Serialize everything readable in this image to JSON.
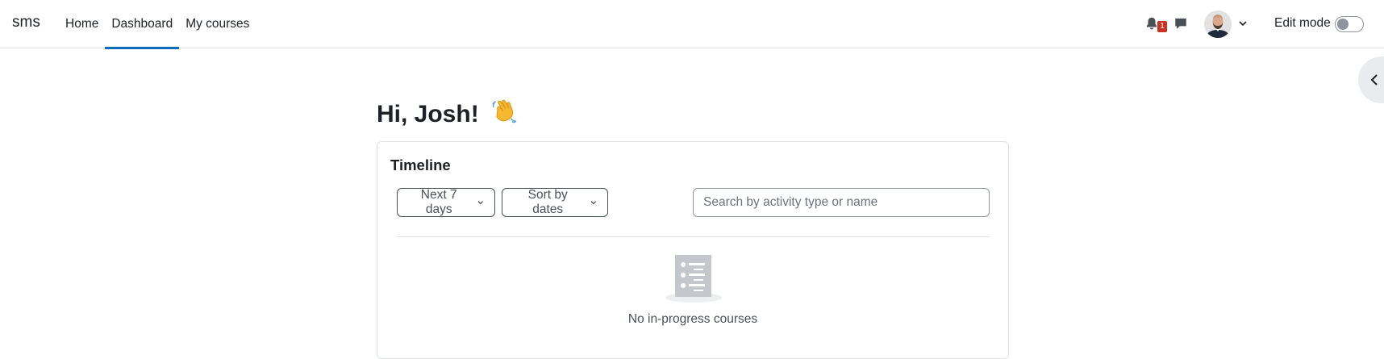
{
  "navbar": {
    "brand": "sms",
    "items": [
      {
        "label": "Home",
        "active": false
      },
      {
        "label": "Dashboard",
        "active": true
      },
      {
        "label": "My courses",
        "active": false
      }
    ],
    "notification_count": "1",
    "edit_mode_label": "Edit mode",
    "edit_mode_on": false,
    "accent_color": "#0f6cbf",
    "badge_color": "#ca3120"
  },
  "main": {
    "greeting": "Hi, Josh!",
    "greeting_emoji": "wave-icon"
  },
  "timeline": {
    "title": "Timeline",
    "filter_label": "Next 7 days",
    "sort_label": "Sort by dates",
    "search_placeholder": "Search by activity type or name",
    "search_value": "",
    "empty_message": "No in-progress courses"
  }
}
